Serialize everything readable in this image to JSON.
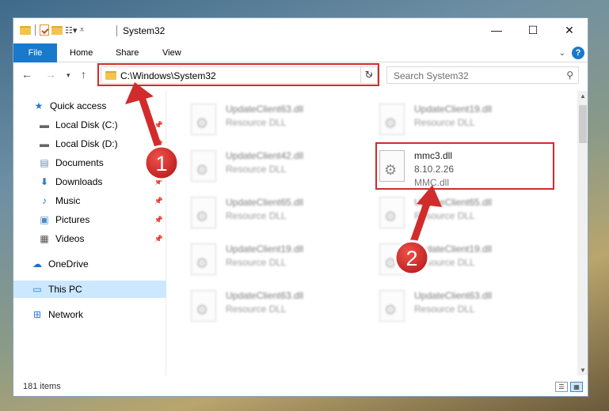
{
  "window": {
    "title": "System32",
    "minimize_glyph": "—",
    "maximize_glyph": "☐",
    "close_glyph": "✕"
  },
  "ribbon": {
    "tabs": [
      {
        "label": "File"
      },
      {
        "label": "Home"
      },
      {
        "label": "Share"
      },
      {
        "label": "View"
      }
    ],
    "help_glyph": "?"
  },
  "navigation": {
    "address": "C:\\Windows\\System32",
    "search_placeholder": "Search System32"
  },
  "sidebar": {
    "items": [
      {
        "label": "Quick access",
        "icon": "star-icon"
      },
      {
        "label": "Local Disk (C:)",
        "icon": "drive-icon",
        "pinned": true
      },
      {
        "label": "Local Disk (D:)",
        "icon": "drive-icon",
        "pinned": true
      },
      {
        "label": "Documents",
        "icon": "documents-icon",
        "pinned": true
      },
      {
        "label": "Downloads",
        "icon": "download-icon",
        "pinned": true
      },
      {
        "label": "Music",
        "icon": "music-icon",
        "pinned": true
      },
      {
        "label": "Pictures",
        "icon": "pictures-icon",
        "pinned": true
      },
      {
        "label": "Videos",
        "icon": "videos-icon",
        "pinned": true
      },
      {
        "label": "OneDrive",
        "icon": "cloud-icon"
      },
      {
        "label": "This PC",
        "icon": "computer-icon",
        "selected": true
      },
      {
        "label": "Network",
        "icon": "network-icon"
      }
    ]
  },
  "files": {
    "blurred": [
      {
        "name": "UpdateClient63.dll",
        "desc": "Resource DLL"
      },
      {
        "name": "UpdateClient19.dll",
        "desc": "Resource DLL"
      },
      {
        "name": "UpdateClient42.dll",
        "desc": "Resource DLL"
      },
      {
        "name": "UpdateClient65.dll",
        "desc": "Resource DLL"
      },
      {
        "name": "UpdateClient65.dll",
        "desc": "Resource DLL"
      },
      {
        "name": "UpdateClient19.dll",
        "desc": "Resource DLL"
      },
      {
        "name": "UpdateClient19.dll",
        "desc": "Resource DLL"
      },
      {
        "name": "UpdateClient63.dll",
        "desc": "Resource DLL"
      },
      {
        "name": "UpdateClient63.dll",
        "desc": "Resource DLL"
      }
    ],
    "highlighted": {
      "name": "mmc3.dll",
      "version": "8.10.2.26",
      "desc": "MMC.dll"
    }
  },
  "status": {
    "item_count": "181 items"
  },
  "annotations": {
    "step1": "1",
    "step2": "2",
    "color": "#d12b2b"
  }
}
